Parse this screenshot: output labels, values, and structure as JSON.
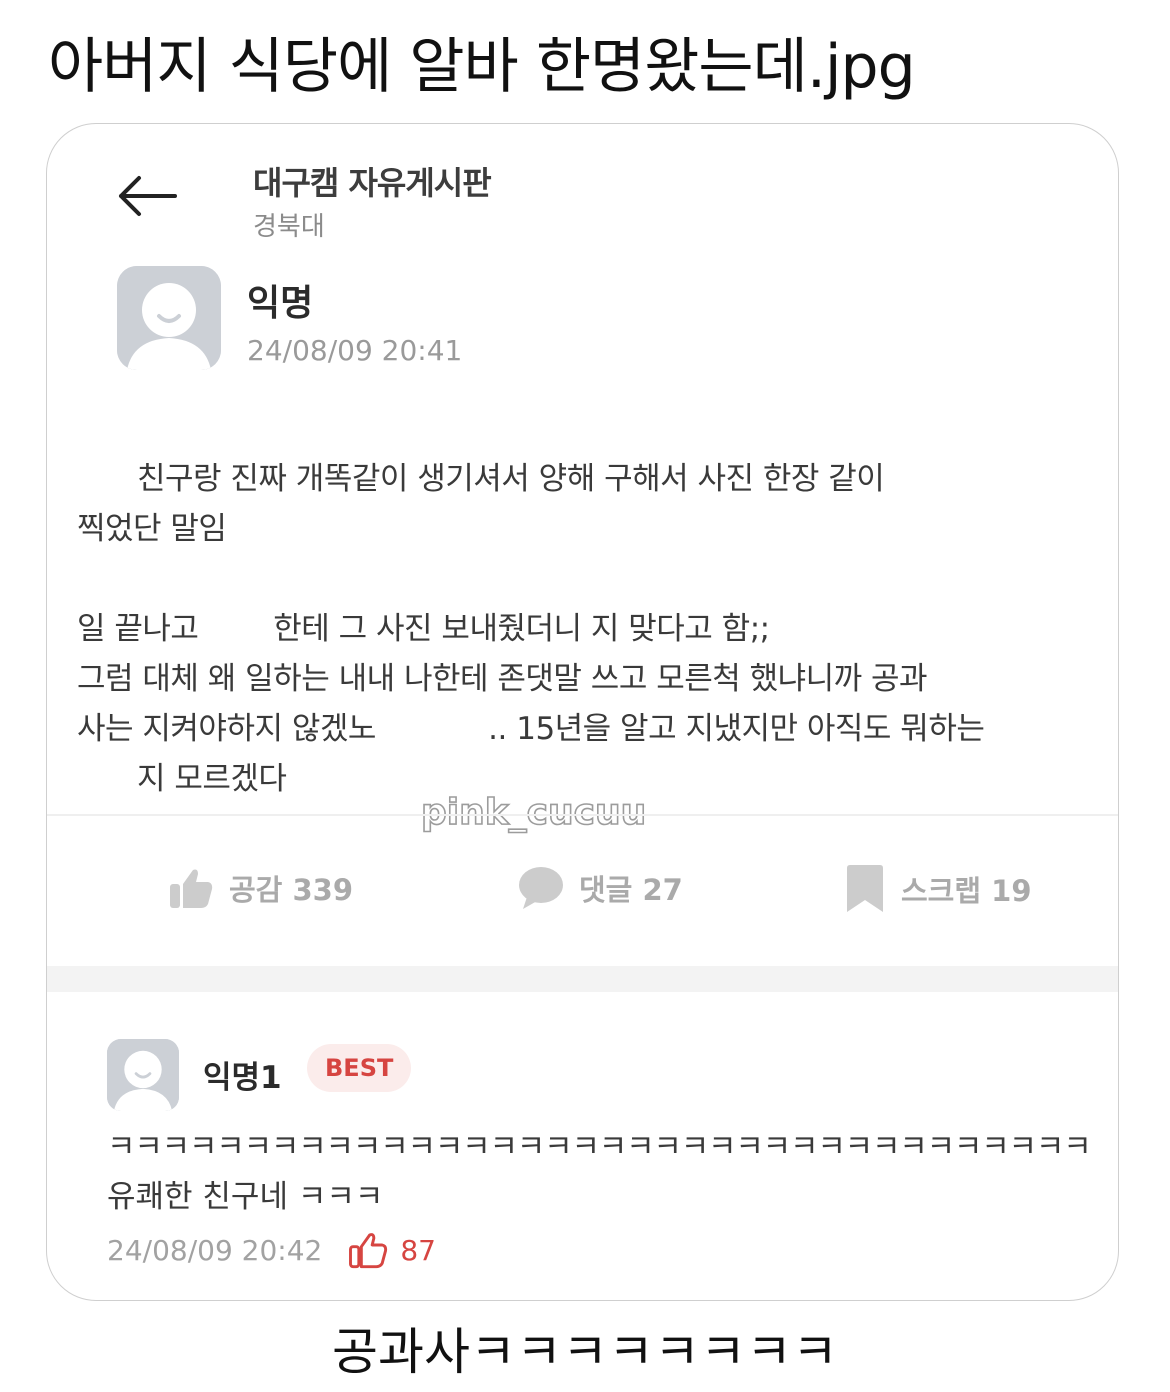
{
  "page_title": "아버지 식당에 알바 한명왔는데.jpg",
  "header": {
    "back_icon": "arrow-left-icon",
    "board_title": "대구캠 자유게시판",
    "board_sub": "경북대"
  },
  "post": {
    "author": "익명",
    "time": "24/08/09 20:41",
    "lines": [
      "친구랑 진짜 개똑같이 생기셔서 양해 구해서 사진 한장 같이",
      "찍었단 말임",
      "일 끝나고        한테 그 사진 보내줬더니 지 맞다고 함;;",
      "그럼 대체 왜 일하는 내내 나한테 존댓말 쓰고 모른척 했냐니까 공과",
      "사는 지켜야하지 않겠노            .. 15년을 알고 지냈지만 아직도 뭐하는",
      "지 모르겠다"
    ],
    "watermark": "pink_cucuu"
  },
  "actions": {
    "like_label": "공감 339",
    "comment_label": "댓글 27",
    "scrap_label": "스크랩 19",
    "icon_color": "#cccccc"
  },
  "comment": {
    "author": "익명1",
    "badge": "BEST",
    "lines": [
      "ㅋㅋㅋㅋㅋㅋㅋㅋㅋㅋㅋㅋㅋㅋㅋㅋㅋㅋㅋㅋㅋㅋㅋㅋㅋㅋㅋㅋㅋㅋㅋㅋㅋㅋㅋㅋ",
      "유쾌한 친구네 ㅋㅋㅋ"
    ],
    "time": "24/08/09 20:42",
    "likes": "87",
    "accent_color": "#d64541"
  },
  "caption": "공과사ㅋㅋㅋㅋㅋㅋㅋㅋ"
}
